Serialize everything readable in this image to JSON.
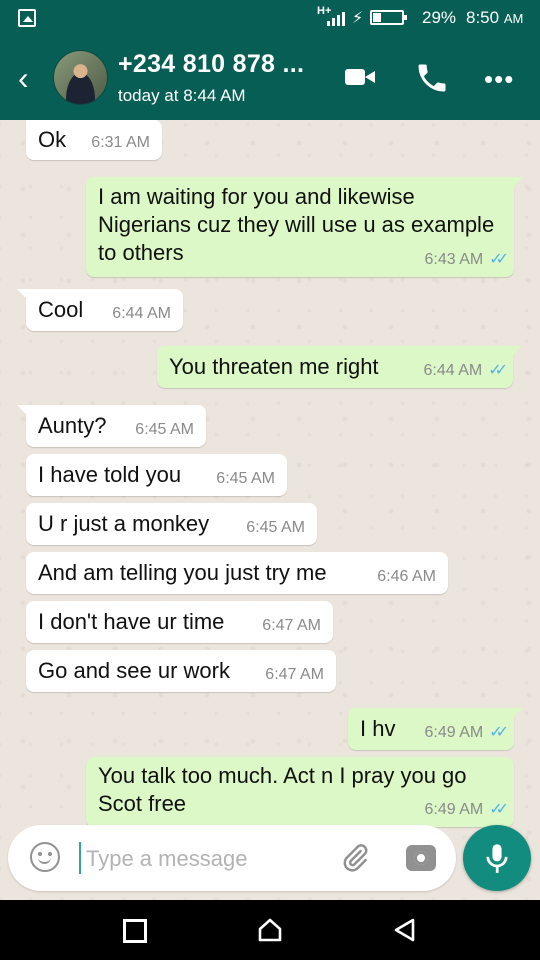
{
  "status_bar": {
    "network": "H+",
    "battery_percent": "29%",
    "battery_level": 0.29,
    "time": "8:50",
    "time_suffix": "AM"
  },
  "header": {
    "contact_name": "+234 810 878 ...",
    "last_seen": "today at 8:44 AM"
  },
  "messages": [
    {
      "direction": "in",
      "text": "Ok",
      "time": "6:31 AM"
    },
    {
      "direction": "out",
      "text": "I am waiting for you and likewise Nigerians cuz they will use u as example to others",
      "time": "6:43 AM",
      "status": "read"
    },
    {
      "direction": "in",
      "text": "Cool",
      "time": "6:44 AM"
    },
    {
      "direction": "out",
      "text": "You threaten me right",
      "time": "6:44 AM",
      "status": "read"
    },
    {
      "direction": "in",
      "text": "Aunty?",
      "time": "6:45 AM"
    },
    {
      "direction": "in",
      "text": "I have told you",
      "time": "6:45 AM"
    },
    {
      "direction": "in",
      "text": "U r just a monkey",
      "time": "6:45 AM"
    },
    {
      "direction": "in",
      "text": "And am telling you just try me",
      "time": "6:46 AM"
    },
    {
      "direction": "in",
      "text": "I don't have ur time",
      "time": "6:47 AM"
    },
    {
      "direction": "in",
      "text": "Go and see ur work",
      "time": "6:47 AM"
    },
    {
      "direction": "out",
      "text": "I hv",
      "time": "6:49 AM",
      "status": "read"
    },
    {
      "direction": "out",
      "text": "You talk too much. Act n I pray you go Scot free",
      "time": "6:49 AM",
      "status": "read"
    }
  ],
  "composer": {
    "placeholder": "Type a message",
    "value": ""
  },
  "colors": {
    "header": "#075e54",
    "outgoing_bubble": "#dcf8c6",
    "incoming_bubble": "#ffffff",
    "read_ticks": "#4fb5ec",
    "mic_button": "#128c7e"
  },
  "icons": [
    "gallery-icon",
    "signal-icon",
    "charging-icon",
    "battery-icon",
    "back-arrow-icon",
    "video-call-icon",
    "phone-call-icon",
    "more-options-icon",
    "emoji-icon",
    "attach-icon",
    "camera-icon",
    "mic-icon",
    "recents-icon",
    "home-icon",
    "back-nav-icon"
  ]
}
